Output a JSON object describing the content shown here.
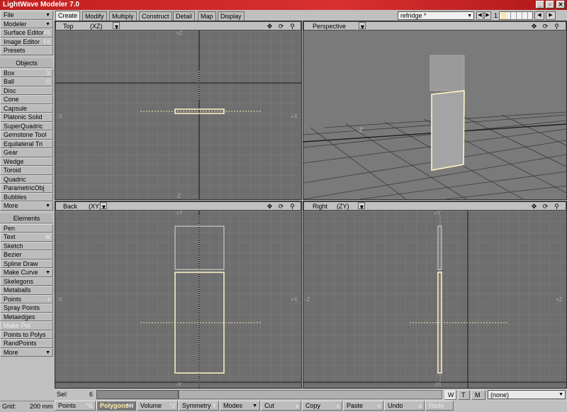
{
  "window": {
    "title": "LightWave Modeler 7.0",
    "min": "_",
    "max": "▫",
    "close": "✕"
  },
  "tabs": [
    "Create",
    "Modify",
    "Multiply",
    "Construct",
    "Detail",
    "Map",
    "Display"
  ],
  "object_selector": "refridge *",
  "layer": "1",
  "left_panel": {
    "top": [
      {
        "label": "File",
        "arrow": "▼"
      },
      {
        "label": "Modeler",
        "arrow": "▼"
      },
      {
        "label": "Surface Editor",
        "key": "F5"
      },
      {
        "label": "Image Editor",
        "key": "F6"
      },
      {
        "label": "Presets"
      }
    ],
    "objects_header": "Objects",
    "objects": [
      {
        "label": "Box",
        "key": "X"
      },
      {
        "label": "Ball",
        "key": "O"
      },
      {
        "label": "Disc"
      },
      {
        "label": "Cone"
      },
      {
        "label": "Capsule"
      },
      {
        "label": "Platonic Solid"
      },
      {
        "label": "SuperQuadric"
      },
      {
        "label": "Gemstone Tool"
      },
      {
        "label": "Equilateral Tri"
      },
      {
        "label": "Gear"
      },
      {
        "label": "Wedge"
      },
      {
        "label": "Toroid"
      },
      {
        "label": "Quadric"
      },
      {
        "label": "ParametricObj"
      },
      {
        "label": "Bubbles"
      },
      {
        "label": "More",
        "arrow": "▼"
      }
    ],
    "elements_header": "Elements",
    "elements": [
      {
        "label": "Pen"
      },
      {
        "label": "Text",
        "key": "W"
      },
      {
        "label": "Sketch"
      },
      {
        "label": "Bezier"
      },
      {
        "label": "Spline Draw"
      },
      {
        "label": "Make Curve",
        "arrow": "▼"
      },
      {
        "label": "Skelegons"
      },
      {
        "label": "Metaballs"
      },
      {
        "label": "Points",
        "key": "+"
      },
      {
        "label": "Spray Points"
      },
      {
        "label": "Metaedges"
      },
      {
        "label": "Make Pol",
        "disabled": true
      },
      {
        "label": "Points to Polys"
      },
      {
        "label": "RandPoints"
      },
      {
        "label": "More",
        "arrow": "▼"
      }
    ]
  },
  "viewports": {
    "top": {
      "name": "Top",
      "axes": "(XZ)",
      "lbl_top": "+Z",
      "lbl_left": "-X",
      "lbl_right": "+X",
      "lbl_bottom": "-Z"
    },
    "persp": {
      "name": "Perspective",
      "lbl_axis": "-Z"
    },
    "back": {
      "name": "Back",
      "axes": "(XY)",
      "lbl_top": "+Y",
      "lbl_left": "-X",
      "lbl_right": "+X",
      "lbl_bottom": "-Y"
    },
    "right": {
      "name": "Right",
      "axes": "(ZY)",
      "lbl_top": "+Y",
      "lbl_left": "-Z",
      "lbl_right": "+Z",
      "lbl_bottom": "-Y"
    }
  },
  "status": {
    "sel_label": "Sel:",
    "sel_value": "6",
    "grid_label": "Grid:",
    "grid_value": "200 mm",
    "wtm": [
      "W",
      "T",
      "M"
    ],
    "surface": "(none)"
  },
  "bottom": [
    {
      "label": "Points",
      "key": "^G"
    },
    {
      "label": "Polygons",
      "key": "^H",
      "on": true
    },
    {
      "label": "Volume",
      "key": "^J"
    },
    {
      "label": "Symmetry",
      "key": "Y"
    },
    {
      "label": "Modes",
      "arrow": "▼"
    },
    {
      "label": "Cut",
      "key": "x"
    },
    {
      "label": "Copy",
      "key": "c"
    },
    {
      "label": "Paste",
      "key": "v"
    },
    {
      "label": "Undo",
      "key": "u"
    },
    {
      "label": "Redo"
    }
  ]
}
